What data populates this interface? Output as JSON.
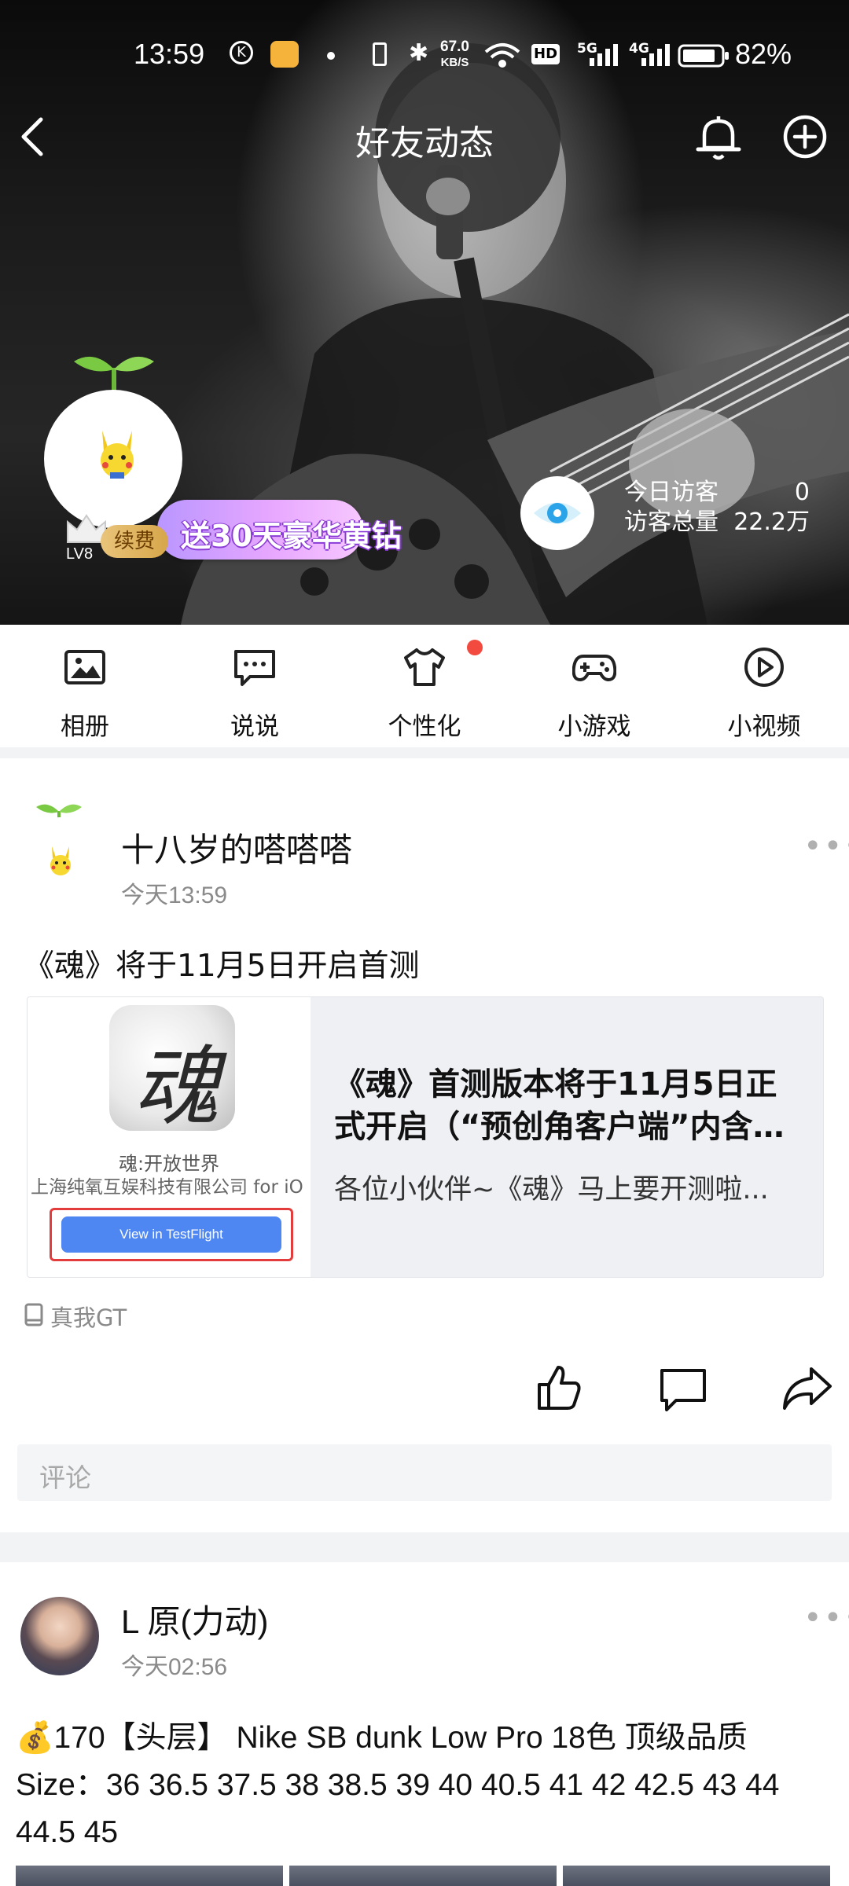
{
  "status_bar": {
    "time": "13:59",
    "speed_value": "67.0",
    "speed_unit": "KB/S",
    "battery_percent": "82%",
    "network_labels": [
      "HD",
      "5G",
      "4G"
    ]
  },
  "header": {
    "title": "好友动态",
    "back_icon": "back-arrow-icon",
    "bell_icon": "bell-icon",
    "add_icon": "plus-circle-icon"
  },
  "profile": {
    "promo_text": "送30天豪华黄钻",
    "renew_label": "续费",
    "level_label": "LV8",
    "visitors_today_label": "今日访客",
    "visitors_today_value": "0",
    "visitors_total_label": "访客总量",
    "visitors_total_value": "22.2万"
  },
  "shortcuts": [
    {
      "label": "相册",
      "icon": "photo-icon"
    },
    {
      "label": "说说",
      "icon": "chat-bubble-icon"
    },
    {
      "label": "个性化",
      "icon": "shirt-icon",
      "badge": true
    },
    {
      "label": "小游戏",
      "icon": "gamepad-icon"
    },
    {
      "label": "小视频",
      "icon": "play-icon"
    }
  ],
  "feed": [
    {
      "author": "十八岁的嗒嗒嗒",
      "time": "今天13:59",
      "text": "《魂》将于11月5日开启首测",
      "share": {
        "app_name": "魂:开放世界",
        "app_developer": "上海纯氧互娱科技有限公司 for iO",
        "button_label": "View in TestFlight",
        "app_icon_glyph": "魂",
        "title": "《魂》首测版本将于11月5日正式开启（“预创角客户端”内含…",
        "description": "各位小伙伴~《魂》马上要开测啦..."
      },
      "device": "真我GT",
      "comment_placeholder": "评论"
    },
    {
      "author": "L 原(力动)",
      "time": "今天02:56",
      "text": "💰170【头层】 Nike SB dunk Low Pro 18色 顶级品质 Size：36 36.5 37.5 38 38.5 39 40 40.5 41 42 42.5 43 44 44.5 45"
    }
  ],
  "colors": {
    "accent_blue": "#4f87f2",
    "badge_red": "#f24a3e",
    "promo_purple": "#b996ff",
    "eye_blue": "#2aa3e8"
  }
}
